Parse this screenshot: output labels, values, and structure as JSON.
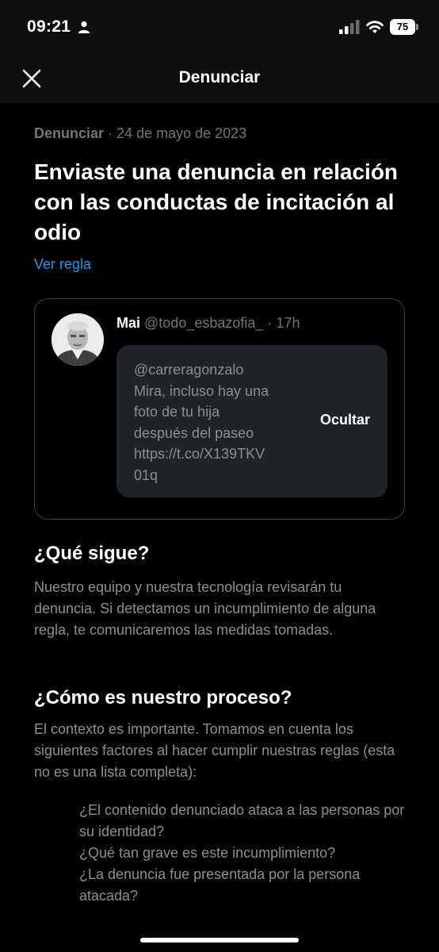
{
  "status_bar": {
    "time": "09:21",
    "battery_level": "75",
    "icons": [
      "person-icon",
      "signal-icon",
      "wifi-icon",
      "battery-icon"
    ]
  },
  "nav": {
    "close_icon": "close-icon",
    "title": "Denunciar"
  },
  "report": {
    "label": "Denunciar",
    "separator": " · ",
    "date": "24 de mayo de 2023",
    "headline": "Enviaste una denuncia en relación con las conductas de incitación al odio",
    "rule_link": "Ver regla"
  },
  "tweet": {
    "name": "Mai",
    "handle": "@todo_esbazofia_",
    "separator": " · ",
    "time": "17h",
    "hidden_lines": [
      "@carreragonzalo",
      "Mira, incluso hay una",
      "foto de tu hija",
      "después del paseo",
      "https://t.co/X139TKV",
      "01q"
    ],
    "hide_label": "Ocultar"
  },
  "next": {
    "heading": "¿Qué sigue?",
    "body": "Nuestro equipo y nuestra tecnología revisarán tu denuncia. Si detectamos un incumplimiento de alguna regla, te comunicaremos las medidas tomadas."
  },
  "process": {
    "heading": "¿Cómo es nuestro proceso?",
    "body": "El contexto es importante. Tomamos en cuenta los siguientes factores al hacer cumplir nuestras reglas (esta no es una lista completa):",
    "questions": [
      "¿El contenido denunciado ataca a las personas por su identidad?",
      "¿Qué tan grave es este incumplimiento?",
      "¿La denuncia fue presentada por la persona atacada?"
    ]
  },
  "colors": {
    "background": "#000000",
    "bar_background": "#0f0f0f",
    "text_primary": "#e7e9ea",
    "text_secondary": "#71767b",
    "link": "#1d9bf0",
    "card_border": "#3a3d42",
    "hidden_box": "#202327"
  }
}
